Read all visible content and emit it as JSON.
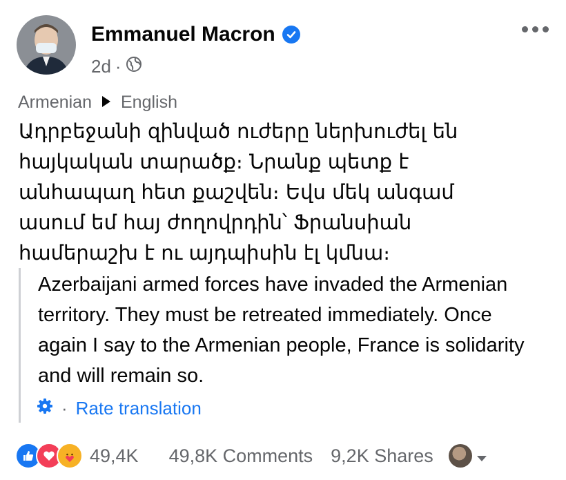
{
  "post": {
    "author": "Emmanuel Macron",
    "time": "2d",
    "separator": "·",
    "audience_icon": "globe-icon",
    "more_icon": "more-options-icon"
  },
  "translation_bar": {
    "from": "Armenian",
    "to": "English",
    "arrow_icon": "play-arrow-icon"
  },
  "original_text": "Ադրբեջանի զինված ուժերը ներխուժել են\nհայկական տարածք։ Նրանք պետք է\nանհապաղ հետ քաշվեն։ Եվս մեկ անգամ\nասում եմ հայ ժողովրդին՝ Ֆրանսիան\nհամերաշխ է ու այդպիսին էլ կմնա։",
  "translated_text": "Azerbaijani armed forces have invaded the Armenian territory. They must be retreated immediately. Once again I say to the Armenian people, France is solidarity and will remain so.",
  "rate": {
    "icon": "gear-icon",
    "separator": "·",
    "label": "Rate translation"
  },
  "footer": {
    "reaction_icons": [
      "like-icon",
      "love-icon",
      "care-icon"
    ],
    "reaction_count": "49,4K",
    "comments": "49,8K Comments",
    "shares": "9,2K Shares",
    "caret_icon": "caret-down-icon"
  },
  "colors": {
    "accent": "#1877f2",
    "verified": "#1877f2",
    "secondary_text": "#65676b",
    "love": "#f33e58",
    "care": "#f7b125"
  }
}
